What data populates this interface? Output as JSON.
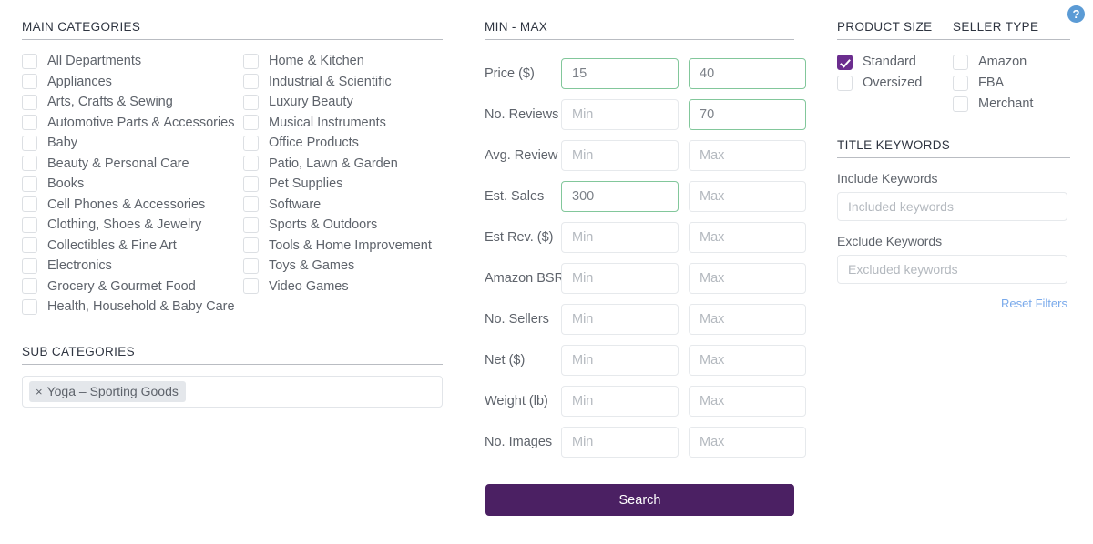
{
  "left": {
    "main_categories_header": "MAIN CATEGORIES",
    "main_categories_col1": [
      {
        "label": "All Departments",
        "checked": false
      },
      {
        "label": "Appliances",
        "checked": false
      },
      {
        "label": "Arts, Crafts & Sewing",
        "checked": false
      },
      {
        "label": "Automotive Parts & Accessories",
        "checked": false
      },
      {
        "label": "Baby",
        "checked": false
      },
      {
        "label": "Beauty & Personal Care",
        "checked": false
      },
      {
        "label": "Books",
        "checked": false
      },
      {
        "label": "Cell Phones & Accessories",
        "checked": false
      },
      {
        "label": "Clothing, Shoes & Jewelry",
        "checked": false
      },
      {
        "label": "Collectibles & Fine Art",
        "checked": false
      },
      {
        "label": "Electronics",
        "checked": false
      },
      {
        "label": "Grocery & Gourmet Food",
        "checked": false
      },
      {
        "label": "Health, Household & Baby Care",
        "checked": false
      }
    ],
    "main_categories_col2": [
      {
        "label": "Home & Kitchen",
        "checked": false
      },
      {
        "label": "Industrial & Scientific",
        "checked": false
      },
      {
        "label": "Luxury Beauty",
        "checked": false
      },
      {
        "label": "Musical Instruments",
        "checked": false
      },
      {
        "label": "Office Products",
        "checked": false
      },
      {
        "label": "Patio, Lawn & Garden",
        "checked": false
      },
      {
        "label": "Pet Supplies",
        "checked": false
      },
      {
        "label": "Software",
        "checked": false
      },
      {
        "label": "Sports & Outdoors",
        "checked": false
      },
      {
        "label": "Tools & Home Improvement",
        "checked": false
      },
      {
        "label": "Toys & Games",
        "checked": false
      },
      {
        "label": "Video Games",
        "checked": false
      }
    ],
    "sub_categories_header": "SUB CATEGORIES",
    "sub_category_chips": [
      {
        "remove": "×",
        "label": "Yoga – Sporting Goods"
      }
    ]
  },
  "middle": {
    "header": "MIN - MAX",
    "rows": [
      {
        "label": "Price ($)",
        "min_value": "15",
        "min_placeholder": "Min",
        "min_filled": true,
        "max_value": "40",
        "max_placeholder": "Max",
        "max_filled": true
      },
      {
        "label": "No. Reviews",
        "min_value": "",
        "min_placeholder": "Min",
        "min_filled": false,
        "max_value": "70",
        "max_placeholder": "Max",
        "max_filled": true
      },
      {
        "label": "Avg. Review",
        "min_value": "",
        "min_placeholder": "Min",
        "min_filled": false,
        "max_value": "",
        "max_placeholder": "Max",
        "max_filled": false
      },
      {
        "label": "Est. Sales",
        "min_value": "300",
        "min_placeholder": "Min",
        "min_filled": true,
        "max_value": "",
        "max_placeholder": "Max",
        "max_filled": false
      },
      {
        "label": "Est Rev. ($)",
        "min_value": "",
        "min_placeholder": "Min",
        "min_filled": false,
        "max_value": "",
        "max_placeholder": "Max",
        "max_filled": false
      },
      {
        "label": "Amazon BSR",
        "min_value": "",
        "min_placeholder": "Min",
        "min_filled": false,
        "max_value": "",
        "max_placeholder": "Max",
        "max_filled": false
      },
      {
        "label": "No. Sellers",
        "min_value": "",
        "min_placeholder": "Min",
        "min_filled": false,
        "max_value": "",
        "max_placeholder": "Max",
        "max_filled": false
      },
      {
        "label": "Net ($)",
        "min_value": "",
        "min_placeholder": "Min",
        "min_filled": false,
        "max_value": "",
        "max_placeholder": "Max",
        "max_filled": false
      },
      {
        "label": "Weight (lb)",
        "min_value": "",
        "min_placeholder": "Min",
        "min_filled": false,
        "max_value": "",
        "max_placeholder": "Max",
        "max_filled": false
      },
      {
        "label": "No. Images",
        "min_value": "",
        "min_placeholder": "Min",
        "min_filled": false,
        "max_value": "",
        "max_placeholder": "Max",
        "max_filled": false
      }
    ],
    "search_label": "Search"
  },
  "right": {
    "product_size_header": "PRODUCT SIZE",
    "product_size_options": [
      {
        "label": "Standard",
        "checked": true
      },
      {
        "label": "Oversized",
        "checked": false
      }
    ],
    "seller_type_header": "SELLER TYPE",
    "seller_type_options": [
      {
        "label": "Amazon",
        "checked": false
      },
      {
        "label": "FBA",
        "checked": false
      },
      {
        "label": "Merchant",
        "checked": false
      }
    ],
    "title_keywords_header": "TITLE KEYWORDS",
    "include_label": "Include Keywords",
    "include_value": "",
    "include_placeholder": "Included keywords",
    "exclude_label": "Exclude Keywords",
    "exclude_value": "",
    "exclude_placeholder": "Excluded keywords",
    "reset_label": "Reset Filters"
  },
  "help": {
    "glyph": "?"
  },
  "colors": {
    "accent_purple": "#4b2063",
    "checkbox_purple": "#6b2d8e",
    "filled_border_green": "#82c79b",
    "link_blue": "#7aaaeb",
    "help_blue": "#5b9bd5"
  }
}
